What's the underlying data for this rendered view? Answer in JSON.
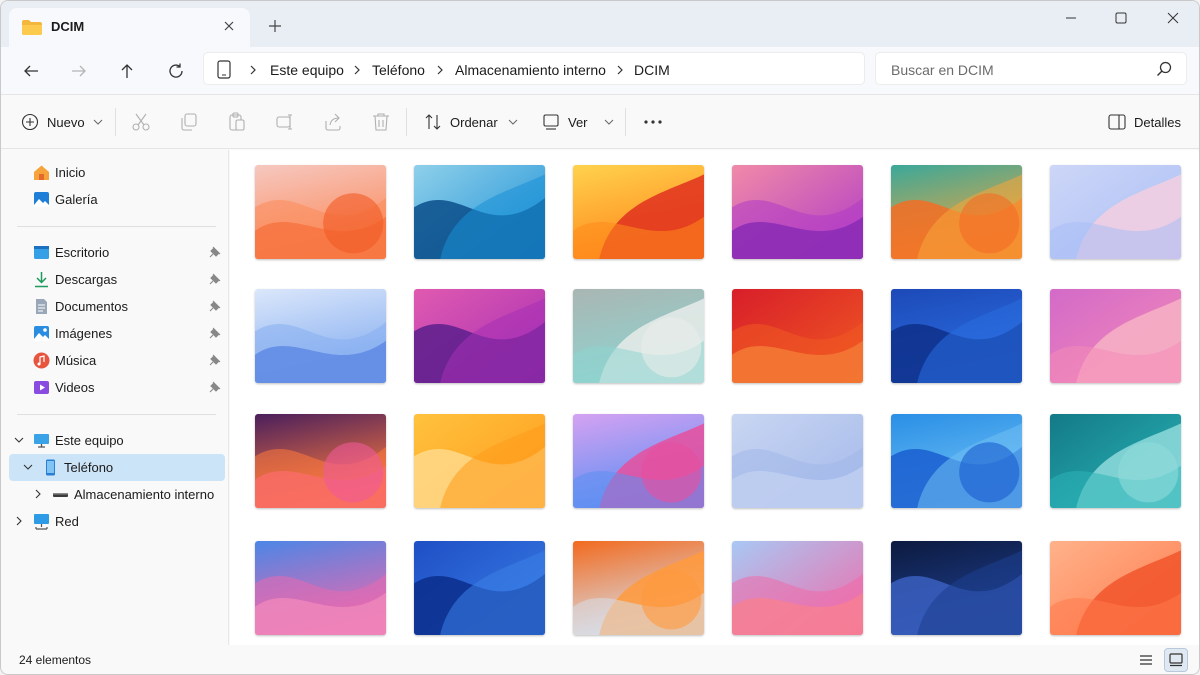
{
  "window": {
    "tab_title": "DCIM"
  },
  "address": {
    "crumbs": [
      "Este equipo",
      "Teléfono",
      "Almacenamiento interno",
      "DCIM"
    ],
    "search_placeholder": "Buscar en DCIM"
  },
  "toolbar": {
    "new_label": "Nuevo",
    "sort_label": "Ordenar",
    "view_label": "Ver",
    "details_label": "Detalles"
  },
  "sidebar": {
    "top": [
      {
        "label": "Inicio",
        "icon": "home-icon"
      },
      {
        "label": "Galería",
        "icon": "gallery-icon"
      }
    ],
    "quick": [
      {
        "label": "Escritorio",
        "icon": "desktop-icon"
      },
      {
        "label": "Descargas",
        "icon": "downloads-icon"
      },
      {
        "label": "Documentos",
        "icon": "documents-icon"
      },
      {
        "label": "Imágenes",
        "icon": "pictures-icon"
      },
      {
        "label": "Música",
        "icon": "music-icon"
      },
      {
        "label": "Videos",
        "icon": "videos-icon"
      }
    ],
    "tree": [
      {
        "label": "Este equipo",
        "icon": "pc-icon"
      },
      {
        "label": "Teléfono",
        "icon": "phone-icon"
      },
      {
        "label": "Almacenamiento interno",
        "icon": "drive-icon"
      },
      {
        "label": "Red",
        "icon": "network-icon"
      }
    ]
  },
  "thumbnails": [
    [
      "#f6c8c0",
      "#fb8a5a",
      "#f15a24"
    ],
    [
      "#8fd0ea",
      "#1a8fd6",
      "#0b4e8a"
    ],
    [
      "#ffd24d",
      "#ff8a1c",
      "#e0301e"
    ],
    [
      "#f08aa8",
      "#b03ac7",
      "#5a1aa0"
    ],
    [
      "#3aa89a",
      "#f6a53a",
      "#f36d25"
    ],
    [
      "#cdd6f7",
      "#a9bef6",
      "#f4cfe0"
    ],
    [
      "#dbe7fb",
      "#86aef0",
      "#2f5fd6"
    ],
    [
      "#e05ab0",
      "#a52fb5",
      "#5c1f8c"
    ],
    [
      "#aab6b3",
      "#8fd3cf",
      "#e8ecea"
    ],
    [
      "#d81e2a",
      "#f05a22",
      "#f7a24b"
    ],
    [
      "#1d49b8",
      "#2a6ee0",
      "#0e2f8a"
    ],
    [
      "#d36ac8",
      "#f48ab8",
      "#f7b2c4"
    ],
    [
      "#4a1f5c",
      "#ff7a3d",
      "#f05a9a"
    ],
    [
      "#ffc23d",
      "#ff9a1c",
      "#ffd98a"
    ],
    [
      "#d5a2f2",
      "#5f8ff2",
      "#e84f9e"
    ],
    [
      "#c9d6f2",
      "#a3b8ea",
      "#e4ebfa"
    ],
    [
      "#2a8fe6",
      "#6fc0f4",
      "#1a5ed0"
    ],
    [
      "#137a86",
      "#2bb5b8",
      "#8fdada"
    ],
    [
      "#4c86e6",
      "#e86ab0",
      "#f7a9c8"
    ],
    [
      "#1e4fc4",
      "#3b7fe8",
      "#0b2e8c"
    ],
    [
      "#f26a1f",
      "#d8dde6",
      "#ff9a3d"
    ],
    [
      "#a9c8f4",
      "#f06aa8",
      "#ff9a7a"
    ],
    [
      "#0c1a3f",
      "#1e3f8f",
      "#3a5fc0"
    ],
    [
      "#ffb28a",
      "#ff7a4d",
      "#f2552c"
    ]
  ],
  "status": {
    "count": "24 elementos"
  }
}
